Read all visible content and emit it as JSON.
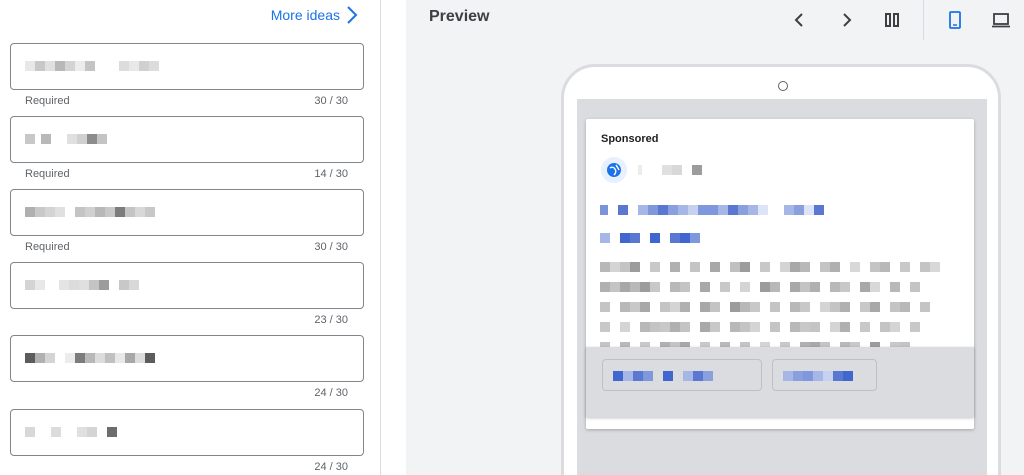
{
  "left_panel": {
    "more_ideas_label": "More ideas",
    "fields": [
      {
        "hint": "Required",
        "count": "30 / 30"
      },
      {
        "hint": "Required",
        "count": "14 / 30"
      },
      {
        "hint": "Required",
        "count": "30 / 30"
      },
      {
        "hint": "",
        "count": "23 / 30"
      },
      {
        "hint": "",
        "count": "24 / 30"
      },
      {
        "hint": "",
        "count": "24 / 30"
      }
    ]
  },
  "right_panel": {
    "preview_title": "Preview",
    "toolbar": {
      "icons": [
        "chevron-left-icon",
        "chevron-right-icon",
        "columns-icon",
        "mobile-icon",
        "desktop-icon"
      ],
      "active_icon": "mobile-icon"
    },
    "ad": {
      "sponsored_label": "Sponsored"
    }
  },
  "colors": {
    "accent": "#1a73e8",
    "border": "#80868b",
    "panel_bg": "#f1f3f4"
  }
}
